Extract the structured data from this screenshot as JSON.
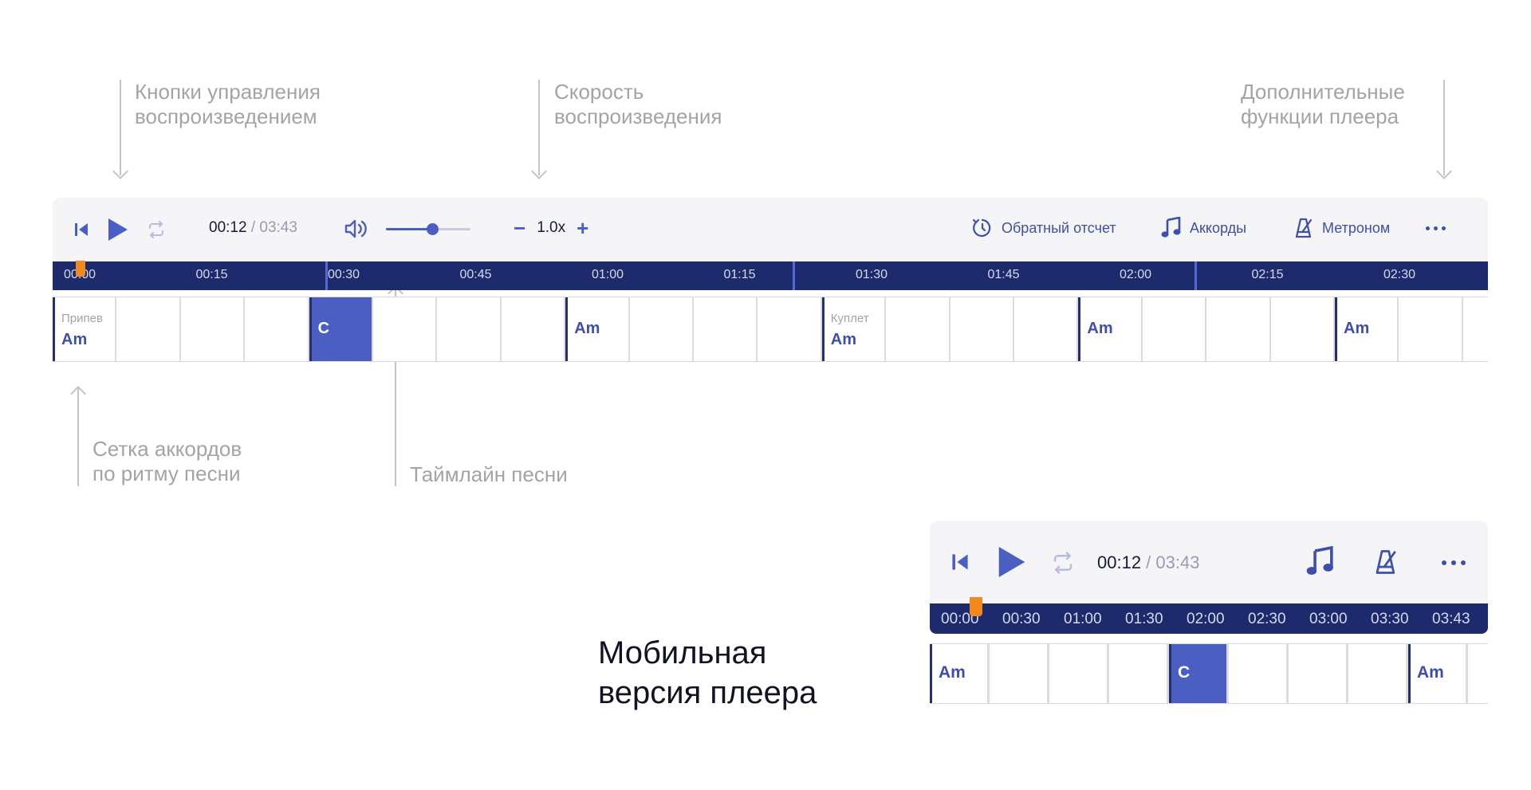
{
  "annotations": {
    "controls": [
      "Кнопки управления",
      "воспроизведением"
    ],
    "speed": [
      "Скорость",
      "воспроизведения"
    ],
    "extra": [
      "Дополнительные",
      "функции плеера"
    ],
    "grid": [
      "Сетка аккордов",
      "по ритму песни"
    ],
    "timeline": [
      "Таймлайн песни"
    ]
  },
  "desktop": {
    "time_current": "00:12",
    "time_separator": " / ",
    "time_total": "03:43",
    "volume_level": 0.55,
    "speed_minus": "−",
    "speed_value": "1.0x",
    "speed_plus": "+",
    "features": [
      {
        "icon": "countdown-icon",
        "label": "Обратный отсчет"
      },
      {
        "icon": "music-note-icon",
        "label": "Аккорды"
      },
      {
        "icon": "metronome-icon",
        "label": "Метроном"
      }
    ],
    "ticks": [
      "00:00",
      "00:15",
      "00:30",
      "00:45",
      "01:00",
      "01:15",
      "01:30",
      "01:45",
      "02:00",
      "02:15",
      "02:30"
    ],
    "chord_cells": [
      {
        "section": "Припев",
        "chord": "Am",
        "strong": true
      },
      {
        "section": "",
        "chord": "",
        "strong": false
      },
      {
        "section": "",
        "chord": "",
        "strong": false
      },
      {
        "section": "",
        "chord": "",
        "strong": false
      },
      {
        "section": "",
        "chord": "C",
        "strong": true,
        "active": true
      },
      {
        "section": "",
        "chord": "",
        "strong": false
      },
      {
        "section": "",
        "chord": "",
        "strong": false
      },
      {
        "section": "",
        "chord": "",
        "strong": false
      },
      {
        "section": "",
        "chord": "Am",
        "strong": true
      },
      {
        "section": "",
        "chord": "",
        "strong": false
      },
      {
        "section": "",
        "chord": "",
        "strong": false
      },
      {
        "section": "",
        "chord": "",
        "strong": false
      },
      {
        "section": "Куплет",
        "chord": "Am",
        "strong": true
      },
      {
        "section": "",
        "chord": "",
        "strong": false
      },
      {
        "section": "",
        "chord": "",
        "strong": false
      },
      {
        "section": "",
        "chord": "",
        "strong": false
      },
      {
        "section": "",
        "chord": "Am",
        "strong": true
      },
      {
        "section": "",
        "chord": "",
        "strong": false
      },
      {
        "section": "",
        "chord": "",
        "strong": false
      },
      {
        "section": "",
        "chord": "",
        "strong": false
      },
      {
        "section": "",
        "chord": "Am",
        "strong": true
      },
      {
        "section": "",
        "chord": "",
        "strong": false
      },
      {
        "section": "",
        "chord": "",
        "strong": false
      }
    ]
  },
  "mobile": {
    "time_current": "00:12",
    "time_separator": " / ",
    "time_total": "03:43",
    "ticks": [
      "00:00",
      "00:30",
      "01:00",
      "01:30",
      "02:00",
      "02:30",
      "03:00",
      "03:30",
      "03:43"
    ],
    "chord_cells": [
      {
        "chord": "Am",
        "strong": true
      },
      {
        "chord": "",
        "strong": false
      },
      {
        "chord": "",
        "strong": false
      },
      {
        "chord": "",
        "strong": false
      },
      {
        "chord": "C",
        "strong": true,
        "active": true
      },
      {
        "chord": "",
        "strong": false
      },
      {
        "chord": "",
        "strong": false
      },
      {
        "chord": "",
        "strong": false
      },
      {
        "chord": "Am",
        "strong": true
      },
      {
        "chord": "",
        "strong": false
      }
    ],
    "title": [
      "Мобильная",
      "версия плеера"
    ]
  },
  "colors": {
    "accent": "#4a5fc1",
    "timeline_bg": "#1d2a6b",
    "playhead": "#f28a1d",
    "toolbar_bg": "#f5f5f8"
  }
}
